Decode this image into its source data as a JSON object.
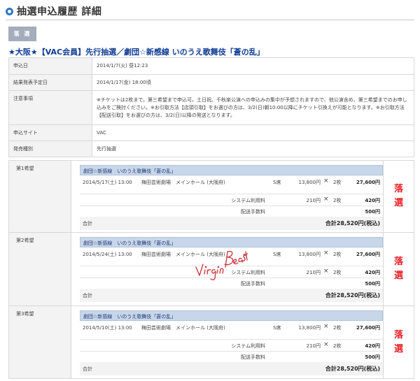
{
  "header": {
    "title": "抽選申込履歴 詳細"
  },
  "status_badge": "落 選",
  "event_title": "★大阪★【VAC会員】先行抽選／劇団☆新感線 いのうえ歌舞伎「蒼の乱」",
  "info": [
    {
      "label": "申込日",
      "value": "2014/1/7(火) 昼12:23"
    },
    {
      "label": "結果発表予定日",
      "value": "2014/1/17(金) 18:00頃"
    },
    {
      "label": "注意事項",
      "value": "※チケットは2枚まで。第三希望まで申込可。土日祝、千秋楽公演への申込みの集中が予想されますので、他公演含め、第三希望までのお申し込みをご検討ください。※お引取方法【店頭引取】をお選びの方は、3/2(日)朝10:00以降にチケット引換えが可能となります。※お引取方法【配送引取】をお選びの方は、3/2(日)以降の発送となります。"
    },
    {
      "label": "申込サイト",
      "value": "VAC"
    },
    {
      "label": "発売種別",
      "value": "先行抽選"
    }
  ],
  "candidates": [
    {
      "label": "第1希望",
      "performance": "劇団☆新感線　いのうえ歌舞伎「蒼の乱」",
      "date": "2014/5/17(土) 13:00",
      "venue": "梅田芸術劇場　メインホール (大阪府)",
      "seat": "S席",
      "unit_price": "13,800円",
      "x": "×",
      "qty": "2枚",
      "total": "27,600円",
      "fee_label": "システム利用料",
      "fee_price": "210円",
      "fee_x": "×",
      "fee_qty": "2枚",
      "fee_total": "420円",
      "delivery_label": "配送手数料",
      "delivery_total": "500円",
      "sum_label": "合計",
      "sum": "合計28,520円(税込)",
      "result": [
        "落",
        "選"
      ]
    },
    {
      "label": "第2希望",
      "performance": "劇団☆新感線　いのうえ歌舞伎「蒼の乱」",
      "date": "2014/5/24(土) 13:00",
      "venue": "梅田芸術劇場　メインホール (大阪府)",
      "seat": "S席",
      "unit_price": "13,800円",
      "x": "×",
      "qty": "2枚",
      "total": "27,600円",
      "fee_label": "システム利用料",
      "fee_price": "210円",
      "fee_x": "×",
      "fee_qty": "2枚",
      "fee_total": "420円",
      "delivery_label": "配送手数料",
      "delivery_total": "500円",
      "sum_label": "合計",
      "sum": "合計28,520円(税込)",
      "result": [
        "落",
        "選"
      ]
    },
    {
      "label": "第3希望",
      "performance": "劇団☆新感線　いのうえ歌舞伎「蒼の乱」",
      "date": "2014/5/10(土) 13:00",
      "venue": "梅田芸術劇場　メインホール (大阪府)",
      "seat": "S席",
      "unit_price": "13,800円",
      "x": "×",
      "qty": "2枚",
      "total": "27,600円",
      "fee_label": "システム利用料",
      "fee_price": "210円",
      "fee_x": "×",
      "fee_qty": "2枚",
      "fee_total": "420円",
      "delivery_label": "配送手数料",
      "delivery_total": "500円",
      "sum_label": "合計",
      "sum": "合計28,520円(税込)",
      "result": [
        "落",
        "選"
      ]
    }
  ],
  "watermark": "Virgin Beast",
  "colors": {
    "accent": "#2e78c4",
    "title": "#0d3b94",
    "result": "#e8232a",
    "perf_bar": "#c8d6ea",
    "badge": "#a3adbb"
  }
}
